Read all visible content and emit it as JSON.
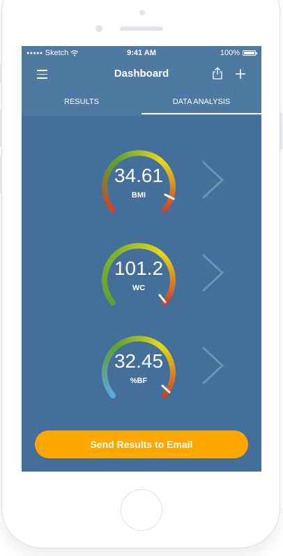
{
  "statusbar": {
    "carrier": "Sketch",
    "time": "9:41 AM",
    "battery": "100%"
  },
  "navbar": {
    "title": "Dashboard",
    "icons": [
      "hamburger-menu-icon",
      "share-icon",
      "plus-icon"
    ]
  },
  "tabs": {
    "items": [
      {
        "label": "RESULTS",
        "active": false
      },
      {
        "label": "DATA ANALYSIS",
        "active": true
      }
    ]
  },
  "metrics": [
    {
      "value": "34.61",
      "label": "BMI",
      "colors": [
        "#c8442d",
        "#5fa035",
        "#e4d61b",
        "#c8442d"
      ]
    },
    {
      "value": "101.2",
      "label": "WC",
      "colors": [
        "#5fa035",
        "#e4d61b",
        "#e4d61b",
        "#c8442d"
      ]
    },
    {
      "value": "32.45",
      "label": "%BF",
      "colors": [
        "#5aa8e2",
        "#5fa035",
        "#e4d61b",
        "#c8442d"
      ]
    }
  ],
  "actions": {
    "send_email": "Send Results to Email"
  },
  "theme": {
    "background": "#436f9a",
    "bar": "#4d79a3",
    "accent": "#ffa600"
  }
}
